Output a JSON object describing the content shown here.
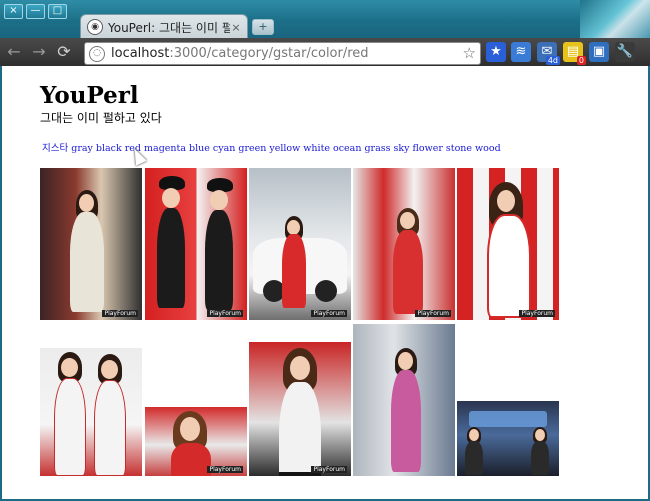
{
  "window": {
    "wm_buttons": [
      "×",
      "—",
      "□"
    ]
  },
  "tab": {
    "title": "YouPerl: 그대는 이미 펄하",
    "close": "×",
    "new_tab": "+"
  },
  "toolbar": {
    "back": "←",
    "forward": "→",
    "reload": "⟳",
    "url_host": "localhost",
    "url_path": ":3000/category/gstar/color/red",
    "star": "☆",
    "extensions": [
      {
        "name": "bookmark-star-icon",
        "glyph": "★",
        "color": "#2a5fd8",
        "badge": ""
      },
      {
        "name": "feed-icon",
        "glyph": "≋",
        "color": "#3a7bd5",
        "badge": ""
      },
      {
        "name": "mail-icon",
        "glyph": "✉",
        "color": "#3c6fb5",
        "badge": "4d"
      },
      {
        "name": "notes-icon",
        "glyph": "▤",
        "color": "#e7c21a",
        "badge": "0"
      },
      {
        "name": "window-icon",
        "glyph": "▣",
        "color": "#2f6fc0",
        "badge": ""
      },
      {
        "name": "wrench-icon",
        "glyph": "🔧",
        "color": "#3a3a3a",
        "badge": ""
      }
    ]
  },
  "page": {
    "title": "YouPerl",
    "subtitle": "그대는 이미 펄하고 있다",
    "tags": [
      "지스타",
      "gray",
      "black",
      "red",
      "magenta",
      "blue",
      "cyan",
      "green",
      "yellow",
      "white",
      "ocean",
      "grass",
      "sky",
      "flower",
      "stone",
      "wood"
    ],
    "watermark": "PlayForum"
  }
}
